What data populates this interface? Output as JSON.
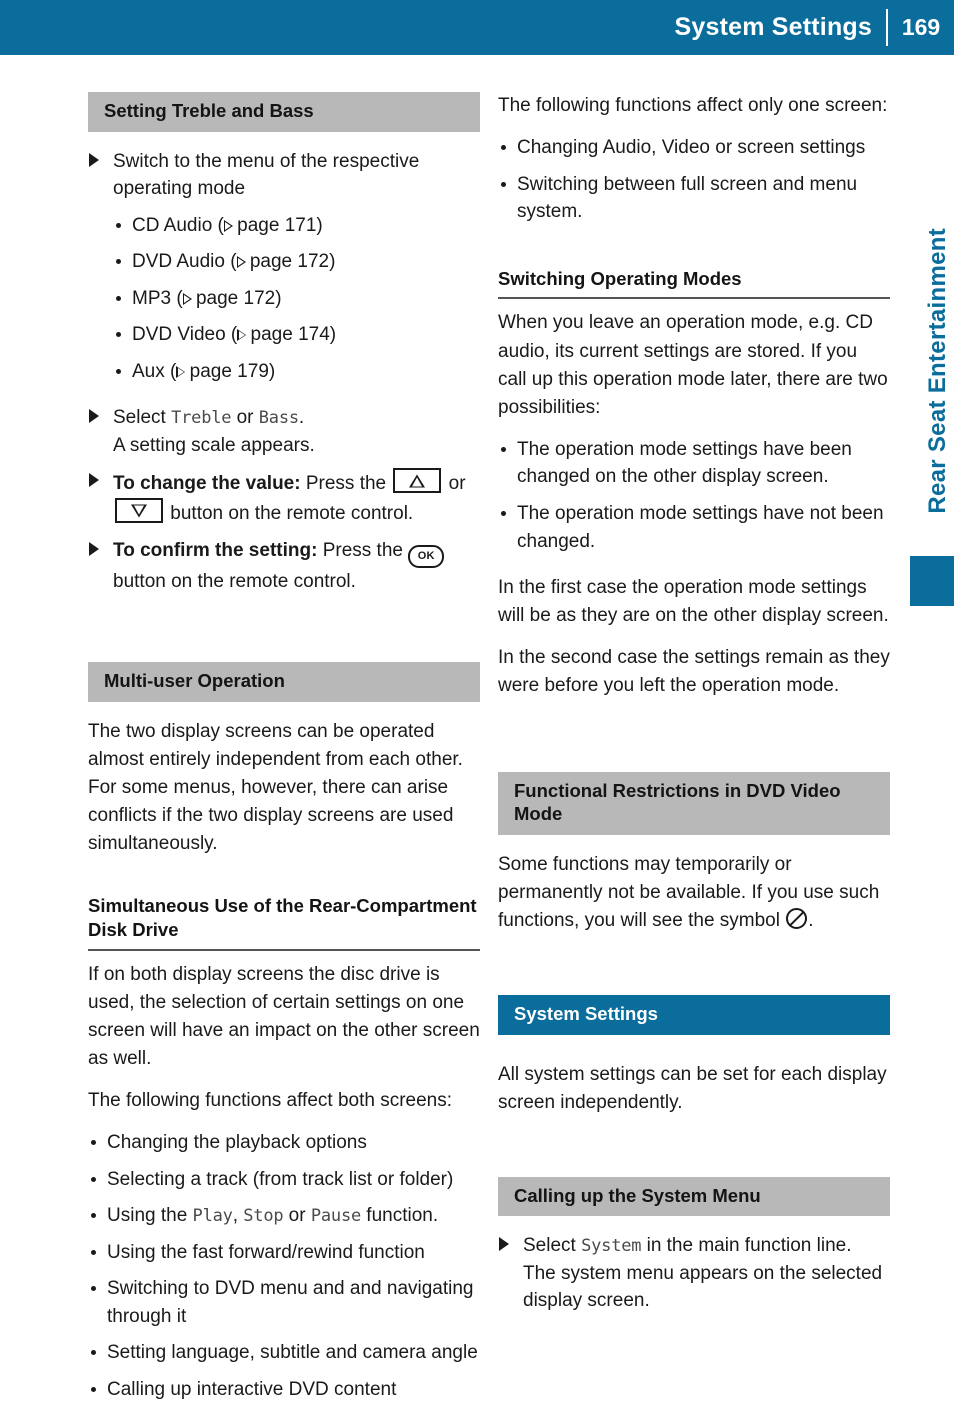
{
  "header": {
    "title": "System Settings",
    "page_number": "169"
  },
  "side_tab": {
    "label": "Rear Seat Entertainment"
  },
  "colors": {
    "brand_blue": "#0a6d9c",
    "heading_gray": "#b8b8b8",
    "body_text": "#1a1a1a",
    "ui_term": "#4a4a4a"
  },
  "left_column": {
    "section_treble_bass": {
      "heading": "Setting Treble and Bass",
      "step_switch": {
        "text": "Switch to the menu of the respective operating mode"
      },
      "mode_list": [
        {
          "label": "CD Audio (",
          "xref": " page 171)"
        },
        {
          "label": "DVD Audio (",
          "xref": " page 172)"
        },
        {
          "label": "MP3 (",
          "xref": " page 172)"
        },
        {
          "label": "DVD Video (",
          "xref": " page 174)"
        },
        {
          "label": "Aux (",
          "xref": " page 179)"
        }
      ],
      "step_select": {
        "lead": "Select ",
        "term1": "Treble",
        "mid": " or ",
        "term2": "Bass",
        "tail": ".",
        "second_line": "A setting scale appears."
      },
      "step_change": {
        "bold": "To change the value:",
        "text_1": " Press the ",
        "text_2": " or ",
        "text_3": " button on the remote control."
      },
      "step_confirm": {
        "bold": "To confirm the setting:",
        "text_1": " Press the ",
        "ok_label": "OK",
        "text_2": " button on the remote control."
      }
    },
    "section_multiuser": {
      "heading": "Multi-user Operation",
      "paragraph": "The two display screens can be operated almost entirely independent from each other. For some menus, however, there can arise conflicts if the two display screens are used simultaneously.",
      "subheading": "Simultaneous Use of the Rear-Compartment Disk Drive",
      "paragraph_2": "If on both display screens the disc drive is used, the selection of certain settings on one screen will have an impact on the other screen as well.",
      "paragraph_3": "The following functions affect both screens:",
      "function_list_1": [
        "Changing the playback options",
        "Selecting a track (from track list or folder)"
      ],
      "function_play": {
        "lead": "Using the ",
        "term1": "Play",
        "sep1": ", ",
        "term2": "Stop",
        "sep2": " or ",
        "term3": "Pause",
        "tail": " function."
      },
      "function_list_2": [
        "Using the fast forward/rewind function",
        "Switching to DVD menu and and navigating through it",
        "Setting language, subtitle and camera angle",
        "Calling up interactive DVD content"
      ]
    }
  },
  "right_column": {
    "intro": {
      "paragraph": "The following functions affect only one screen:",
      "bullets": [
        "Changing Audio, Video or screen settings",
        "Switching between full screen and menu system."
      ]
    },
    "section_switching_modes": {
      "subheading": "Switching Operating Modes",
      "paragraph": "When you leave an operation mode, e.g. CD audio, its current settings are stored. If you call up this operation mode later, there are two possibilities:",
      "bullets": [
        "The operation mode settings have been changed on the other display screen.",
        "The operation mode settings have not been changed."
      ],
      "paragraph_2": "In the first case the operation mode settings will be as they are on the other display screen.",
      "paragraph_3": "In the second case the settings remain as they were before you left the operation mode."
    },
    "section_restrictions": {
      "heading": "Functional Restrictions in DVD Video Mode",
      "paragraph_1": "Some functions may temporarily or permanently not be available. If you use such functions, you will see the symbol ",
      "paragraph_2": "."
    },
    "section_system_settings": {
      "heading": "System Settings",
      "paragraph": "All system settings can be set for each display screen independently."
    },
    "section_system_menu": {
      "heading": "Calling up the System Menu",
      "step": {
        "lead": "Select ",
        "term": "System",
        "tail": " in the main function line.",
        "second_line": "The system menu appears on the selected display screen."
      }
    }
  }
}
